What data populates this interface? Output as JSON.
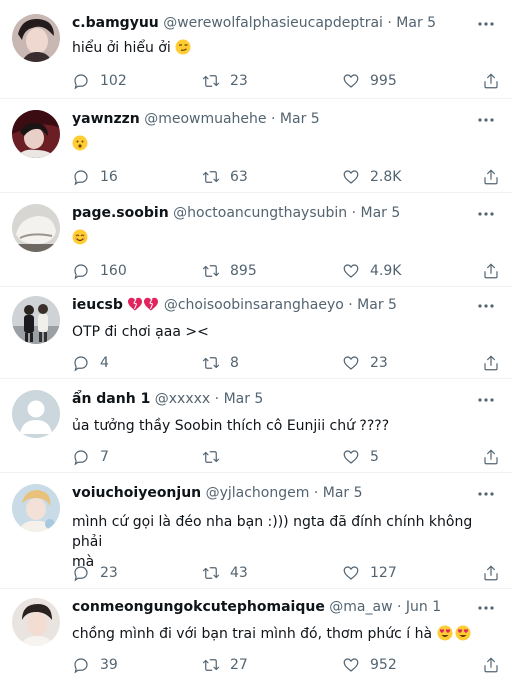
{
  "tweets": [
    {
      "name": "c.bamgyuu",
      "handle": "@werewolfalphasieucapdeptrai",
      "date": "Mar 5",
      "text": "hiểu ởi hiểu ởi",
      "emojis": [
        "smirk-emoji"
      ],
      "replies": "102",
      "retweets": "23",
      "likes": "995"
    },
    {
      "name": "yawnzzn",
      "handle": "@meowmuahehe",
      "date": "Mar 5",
      "text": "",
      "emojis": [
        "pouting-emoji"
      ],
      "replies": "16",
      "retweets": "63",
      "likes": "2.8K"
    },
    {
      "name": "page.soobin",
      "handle": "@hoctoancungthaysubin",
      "date": "Mar 5",
      "text": "",
      "emojis": [
        "smile-emoji"
      ],
      "replies": "160",
      "retweets": "895",
      "likes": "4.9K"
    },
    {
      "name": "ieucsb",
      "handle": "@choisoobinsaranghaeyo",
      "date": "Mar 5",
      "text": "OTP đi chơi ạaa ><",
      "name_emojis": [
        "hearts-emoji",
        "hearts-emoji"
      ],
      "replies": "4",
      "retweets": "8",
      "likes": "23"
    },
    {
      "name": "ẩn danh 1",
      "handle": "@xxxxx",
      "date": "Mar 5",
      "text": "ủa tưởng thầy Soobin thích cô Eunjii chứ ????",
      "replies": "7",
      "retweets": "",
      "likes": "5"
    },
    {
      "name": "voiuchoiyeonjun",
      "handle": "@yjlachongem",
      "date": "Mar 5",
      "text_line1": "mình cứ gọi là đéo nha bạn :))) ngta đã đính chính không phải",
      "text_line2": "mà",
      "replies": "23",
      "retweets": "43",
      "likes": "127"
    },
    {
      "name": "conmeongungokcutephomaique",
      "handle": "@ma_aw",
      "date": "Jun 1",
      "text": "chồng mình đi với bạn trai mình đó, thơm phức í hà",
      "emojis": [
        "heart-eyes-emoji",
        "heart-eyes-emoji"
      ],
      "replies": "39",
      "retweets": "27",
      "likes": "952"
    }
  ],
  "ui": {
    "dot": "·"
  },
  "colors": {
    "text": "#0f1419",
    "muted": "#536471",
    "separator": "#eff3f4"
  }
}
